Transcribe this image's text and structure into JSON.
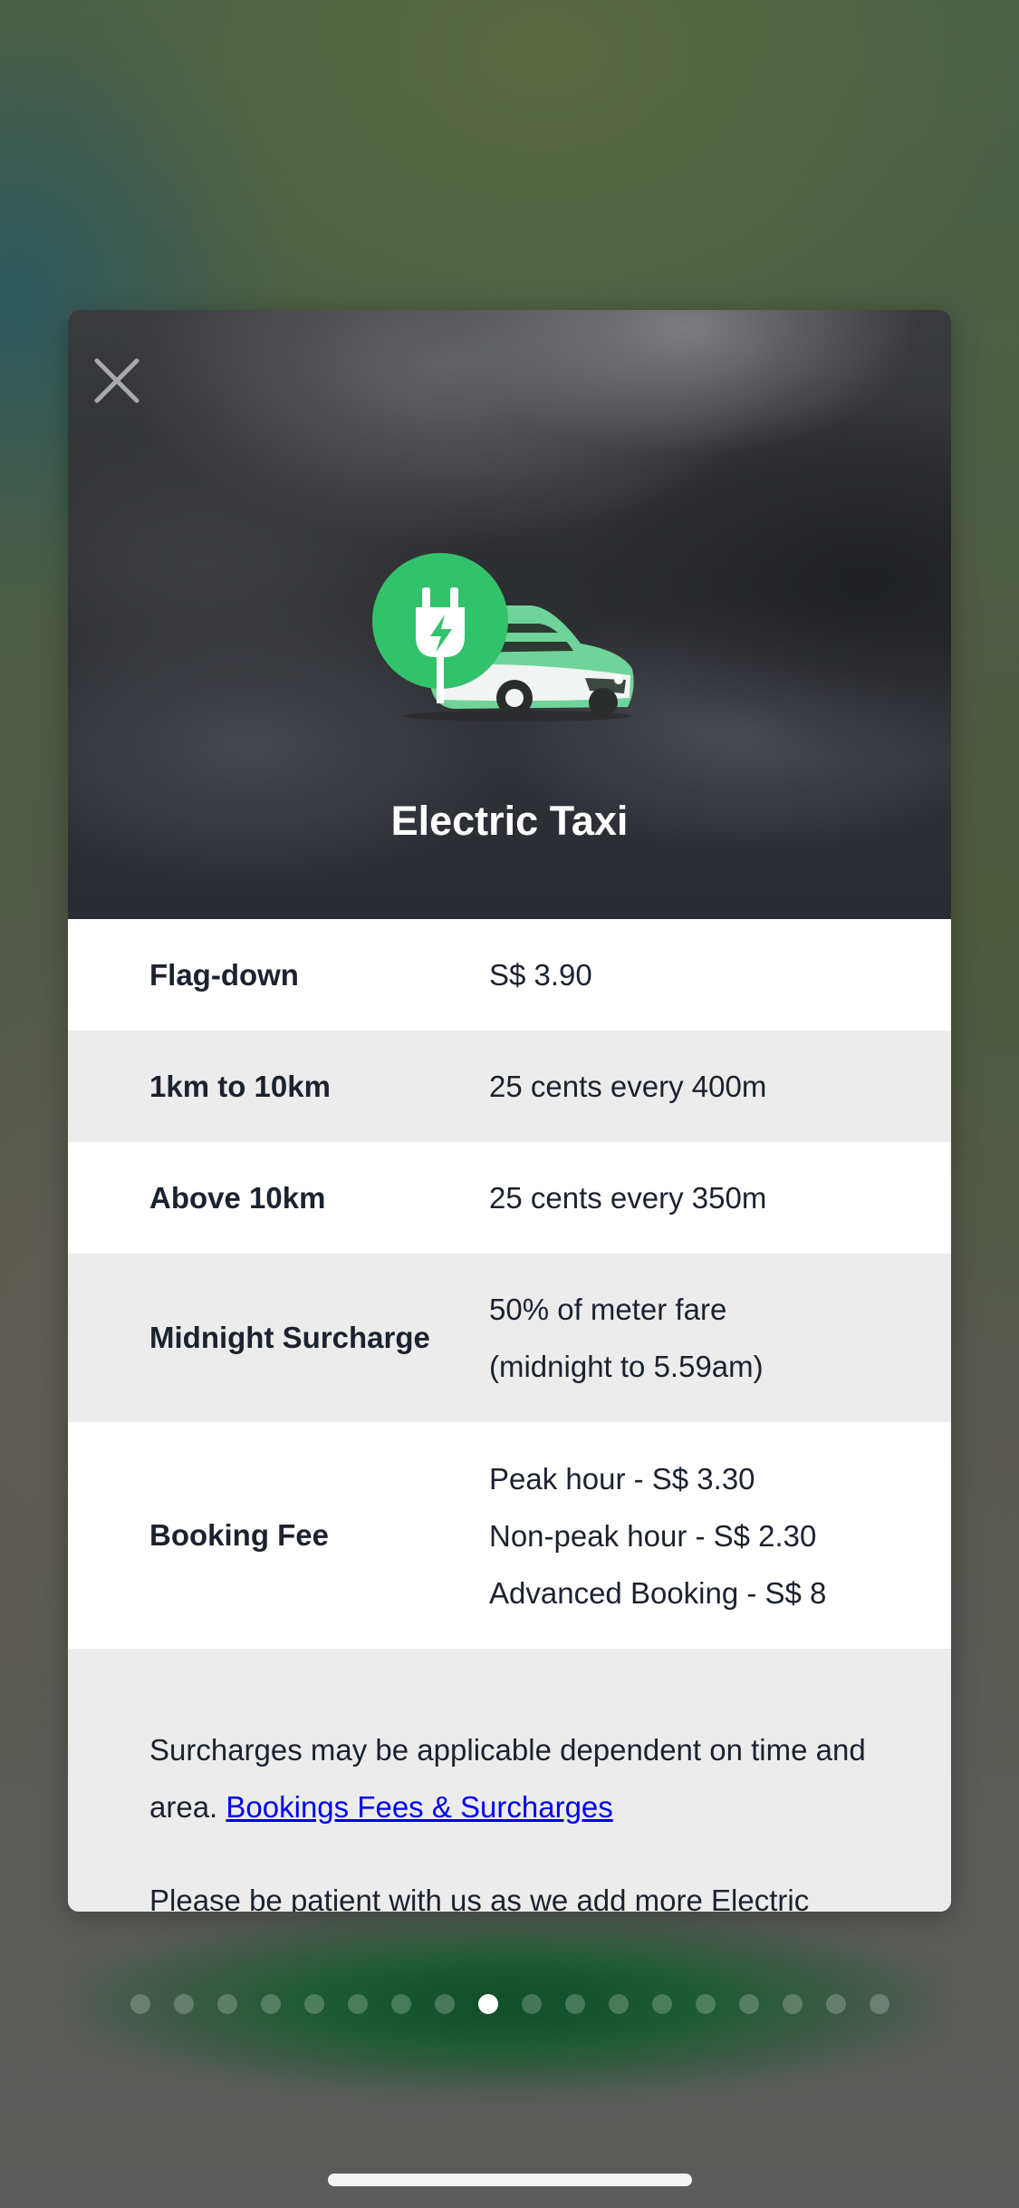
{
  "modal": {
    "close_label": "×",
    "title": "Electric Taxi",
    "icon": "electric-taxi-icon",
    "accent_color": "#33c26c"
  },
  "fares": [
    {
      "label": "Flag-down",
      "value": [
        "S$ 3.90"
      ]
    },
    {
      "label": "1km to 10km",
      "value": [
        "25 cents every 400m"
      ]
    },
    {
      "label": "Above 10km",
      "value": [
        "25 cents every 350m"
      ]
    },
    {
      "label": "Midnight Surcharge",
      "value": [
        "50% of meter fare",
        "(midnight to 5.59am)"
      ]
    },
    {
      "label": "Booking Fee",
      "value": [
        "Peak hour - S$ 3.30",
        "Non-peak hour - S$ 2.30",
        "Advanced Booking - S$ 8"
      ]
    }
  ],
  "notes": {
    "surcharge_text": "Surcharges may be applicable dependent on time and area. ",
    "surcharge_link": "Bookings Fees & Surcharges",
    "patience_text": "Please be patient with us as we add more Electric"
  },
  "pager": {
    "total": 18,
    "active_index": 8
  }
}
